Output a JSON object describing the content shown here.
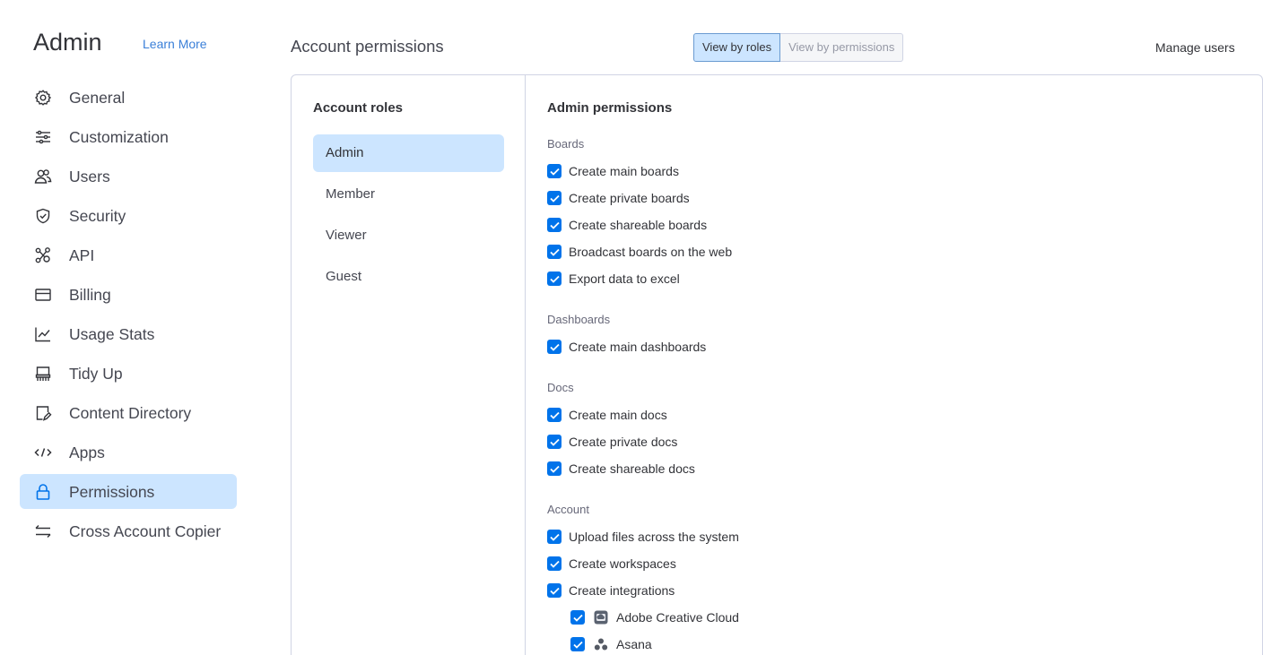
{
  "sidebar": {
    "title": "Admin",
    "learn_more": "Learn More",
    "items": [
      {
        "label": "General",
        "icon": "gear-icon"
      },
      {
        "label": "Customization",
        "icon": "sliders-icon"
      },
      {
        "label": "Users",
        "icon": "users-icon"
      },
      {
        "label": "Security",
        "icon": "shield-icon"
      },
      {
        "label": "API",
        "icon": "api-icon"
      },
      {
        "label": "Billing",
        "icon": "credit-card-icon"
      },
      {
        "label": "Usage Stats",
        "icon": "chart-icon"
      },
      {
        "label": "Tidy Up",
        "icon": "broom-icon"
      },
      {
        "label": "Content Directory",
        "icon": "document-edit-icon"
      },
      {
        "label": "Apps",
        "icon": "code-icon"
      },
      {
        "label": "Permissions",
        "icon": "lock-icon",
        "active": true
      },
      {
        "label": "Cross Account Copier",
        "icon": "transfer-arrows-icon"
      }
    ]
  },
  "header": {
    "title": "Account permissions",
    "view_by_roles": "View by roles",
    "view_by_permissions": "View by permissions",
    "active_view": "View by roles",
    "manage_users": "Manage users"
  },
  "roles": {
    "heading": "Account roles",
    "items": [
      "Admin",
      "Member",
      "Viewer",
      "Guest"
    ],
    "selected": "Admin"
  },
  "permissions": {
    "heading": "Admin permissions",
    "groups": [
      {
        "label": "Boards",
        "items": [
          {
            "label": "Create main boards",
            "checked": true
          },
          {
            "label": "Create private boards",
            "checked": true
          },
          {
            "label": "Create shareable boards",
            "checked": true
          },
          {
            "label": "Broadcast boards on the web",
            "checked": true
          },
          {
            "label": "Export data to excel",
            "checked": true
          }
        ]
      },
      {
        "label": "Dashboards",
        "items": [
          {
            "label": "Create main dashboards",
            "checked": true
          }
        ]
      },
      {
        "label": "Docs",
        "items": [
          {
            "label": "Create main docs",
            "checked": true
          },
          {
            "label": "Create private docs",
            "checked": true
          },
          {
            "label": "Create shareable docs",
            "checked": true
          }
        ]
      },
      {
        "label": "Account",
        "items": [
          {
            "label": "Upload files across the system",
            "checked": true
          },
          {
            "label": "Create workspaces",
            "checked": true
          },
          {
            "label": "Create integrations",
            "checked": true
          }
        ]
      }
    ],
    "integrations": [
      {
        "label": "Adobe Creative Cloud",
        "icon": "adobe-creative-cloud-icon",
        "checked": true
      },
      {
        "label": "Asana",
        "icon": "asana-icon",
        "checked": true
      }
    ]
  },
  "colors": {
    "accent": "#0073ea",
    "active_bg": "#cce5ff",
    "link": "#3a7fd8",
    "border": "#d0d4e4"
  }
}
